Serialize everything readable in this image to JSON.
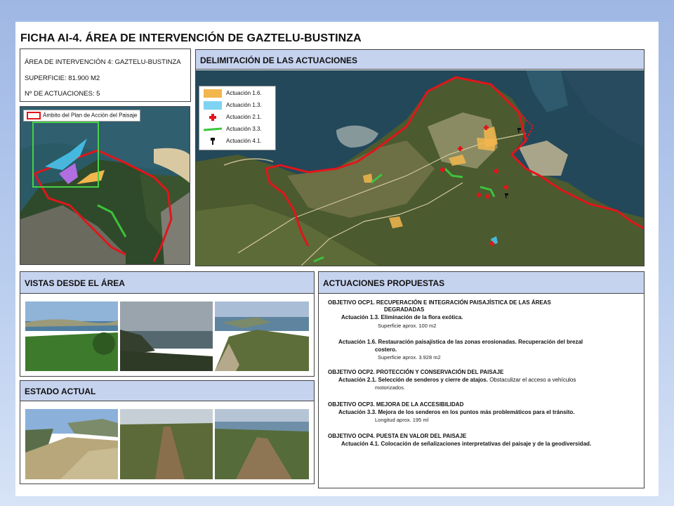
{
  "title": "FICHA AI-4. ÁREA DE INTERVENCIÓN DE GAZTELU-BUSTINZA",
  "info": {
    "area": "ÁREA DE INTERVENCIÓN 4: GAZTELU-BUSTINZA",
    "superficie": "SUPERFICIE: 81.900 M2",
    "actuaciones": "Nº DE ACTUACIONES: 5"
  },
  "overview_map": {
    "legend": "Ámbito del Plan de Acción del Paisaje"
  },
  "delimitacion": {
    "heading": "DELIMITACIÓN DE LAS ACTUACIONES",
    "legend": [
      {
        "label": "Actuación 1.6.",
        "symbol": "orange-area"
      },
      {
        "label": "Actuación 1.3.",
        "symbol": "cyan-area"
      },
      {
        "label": "Actuación 2.1.",
        "symbol": "red-cross-icon"
      },
      {
        "label": "Actuación 3.3.",
        "symbol": "green-line"
      },
      {
        "label": "Actuación 4.1.",
        "symbol": "sign-icon"
      }
    ]
  },
  "vistas": {
    "heading": "VISTAS DESDE EL ÁREA"
  },
  "estado": {
    "heading": "ESTADO ACTUAL"
  },
  "propuestas": {
    "heading": "ACTUACIONES PROPUESTAS",
    "ocp1": {
      "line1": "OBJETIVO OCP1. RECUPERACIÓN E INTEGRACIÓN PAISAJÍSTICA DE LAS ÁREAS",
      "line2": "DEGRADADAS"
    },
    "a13": {
      "label": "Actuación 1.3. Eliminación de la flora exótica.",
      "sup": "Superficie aprox. 100 m2"
    },
    "a16": {
      "label": "Actuación 1.6. Restauración paisajística de las zonas erosionadas. Recuperación del brezal",
      "label2": "costero.",
      "sup": "Superficie aprox. 3.928 m2"
    },
    "ocp2": {
      "line1": "OBJETIVO OCP2. PROTECCIÓN Y CONSERVACIÓN DEL PAISAJE"
    },
    "a21": {
      "bold": "Actuación 2.1. Selección de senderos y cierre de atajos.",
      "rest": " Obstaculizar el acceso a vehículos",
      "rest2": "motorizados."
    },
    "ocp3": {
      "line1": "OBJETIVO OCP3. MEJORA DE LA ACCESIBILIDAD"
    },
    "a33": {
      "label": "Actuación 3.3. Mejora de los senderos en los puntos más problemáticos para el tránsito.",
      "sup": "Longitud aprox. 195 ml"
    },
    "ocp4": {
      "line1": "OBJETIVO OCP4. PUESTA EN VALOR DEL PAISAJE"
    },
    "a41": {
      "label": "Actuación 4.1. Colocación de señalizaciones interpretativas del paisaje y de la geodiversidad."
    }
  },
  "colors": {
    "header_bg": "#c6d3ef",
    "boundary": "#e0161b",
    "act_1_6": "#f2b64c",
    "act_1_3": "#46c3ec",
    "act_3_3": "#3cc43c"
  }
}
